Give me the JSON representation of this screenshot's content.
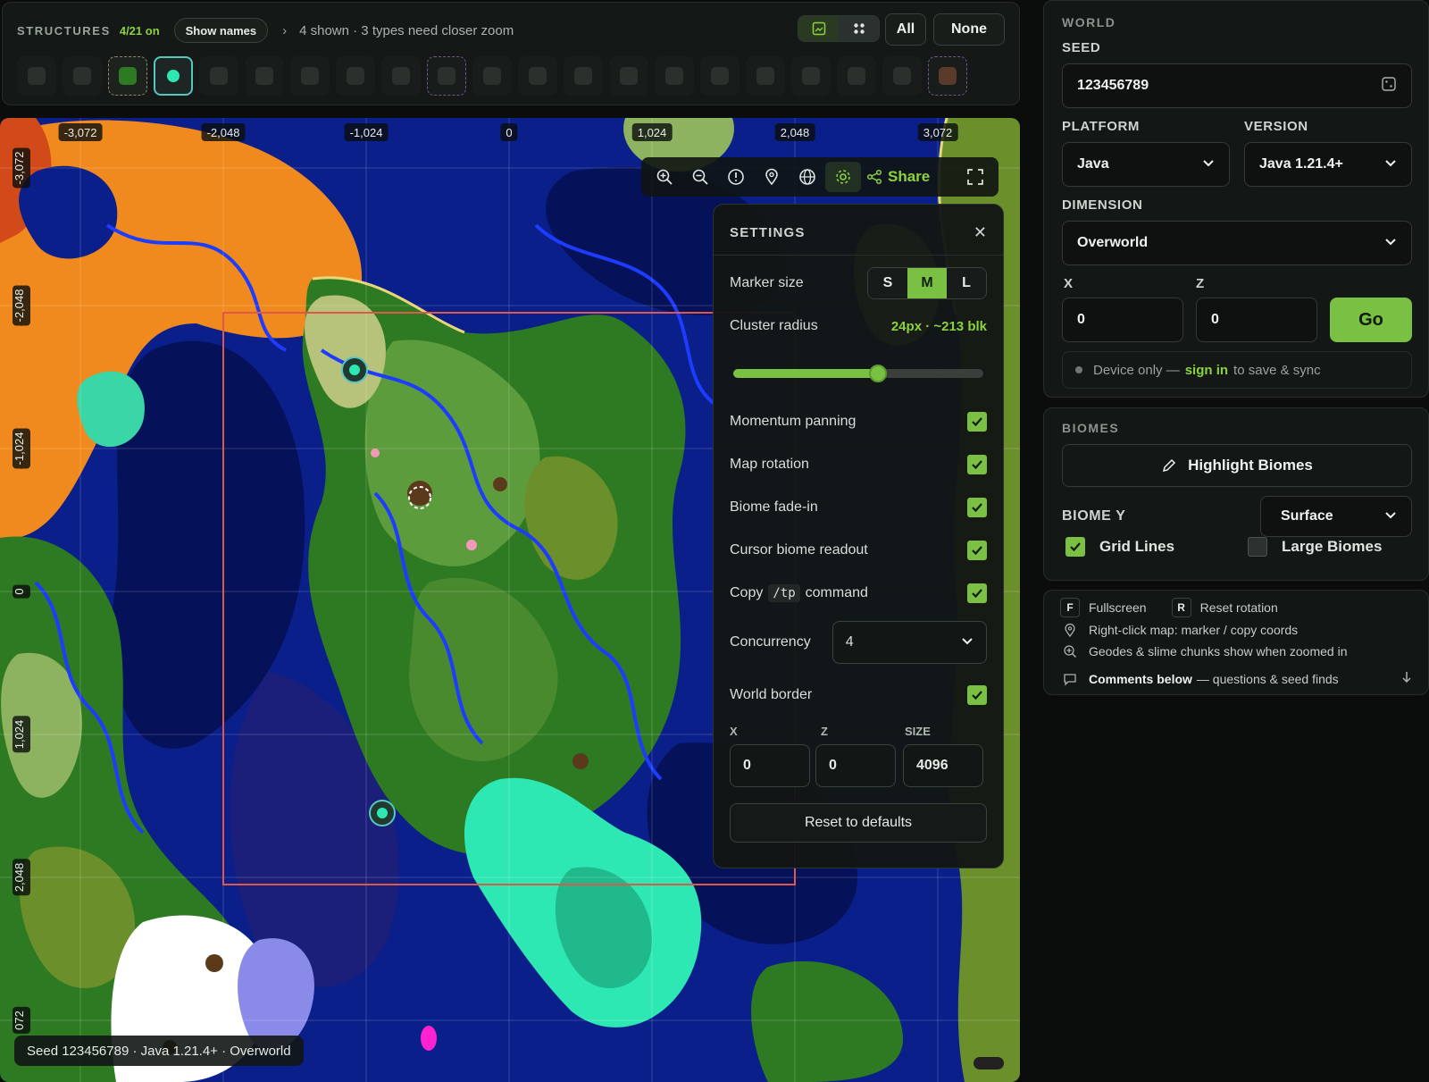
{
  "structures": {
    "title": "STRUCTURES",
    "count": "4/21 on",
    "show_names": "Show names",
    "summary": "4 shown · 3 types need closer zoom",
    "btn_all": "All",
    "btn_none": "None",
    "icons": [
      "ruined-portal-icon",
      "stone-icon",
      "end-city-icon",
      "stronghold-icon",
      "shipwreck-icon",
      "pillager-outpost-icon",
      "village-icon",
      "mineshaft-icon",
      "desert-temple-icon",
      "ancient-city-icon",
      "jungle-temple-icon",
      "witch-hut-icon",
      "igloo-icon",
      "bastion-icon",
      "ocean-monument-icon",
      "woodland-mansion-icon",
      "nether-fortress-icon",
      "ocean-ruin-icon",
      "trail-ruins-icon",
      "trial-chamber-icon",
      "buried-treasure-icon"
    ]
  },
  "map": {
    "top_coords": [
      "-3,072",
      "-2,048",
      "-1,024",
      "0",
      "1,024",
      "2,048",
      "3,072"
    ],
    "left_coords": [
      "-3,072",
      "-2,048",
      "-1,024",
      "0",
      "1,024",
      "2,048",
      "072"
    ],
    "share_label": "Share",
    "footer": "Seed 123456789 · Java 1.21.4+ · Overworld"
  },
  "settings": {
    "title": "SETTINGS",
    "marker_size_label": "Marker size",
    "marker_sizes": [
      "S",
      "M",
      "L"
    ],
    "marker_selected": "M",
    "cluster_label": "Cluster radius",
    "cluster_value": "24px · ~213 blk",
    "cluster_fraction": 0.58,
    "momentum": "Momentum panning",
    "rotation": "Map rotation",
    "fade": "Biome fade-in",
    "readout": "Cursor biome readout",
    "copy_pre": "Copy",
    "copy_code": "/tp",
    "copy_post": "command",
    "concurrency_label": "Concurrency",
    "concurrency_value": "4",
    "world_border": "World border",
    "wb_x_label": "X",
    "wb_z_label": "Z",
    "wb_size_label": "SIZE",
    "wb_x": "0",
    "wb_z": "0",
    "wb_size": "4096",
    "reset": "Reset to defaults"
  },
  "world": {
    "section": "WORLD",
    "seed_label": "SEED",
    "seed_value": "123456789",
    "platform_label": "PLATFORM",
    "platform_value": "Java",
    "version_label": "VERSION",
    "version_value": "Java 1.21.4+",
    "dimension_label": "DIMENSION",
    "dimension_value": "Overworld",
    "x_label": "X",
    "z_label": "Z",
    "x_value": "0",
    "z_value": "0",
    "go": "Go",
    "device_pre": "Device only —",
    "device_link": "sign in",
    "device_post": "to save & sync"
  },
  "biomes": {
    "section": "BIOMES",
    "highlight": "Highlight Biomes",
    "biome_y_label": "BIOME Y",
    "biome_y_value": "Surface",
    "grid_lines": "Grid Lines",
    "large_biomes": "Large Biomes"
  },
  "help": {
    "key_f": "F",
    "fullscreen": "Fullscreen",
    "key_r": "R",
    "reset_rotation": "Reset rotation",
    "right_click": "Right-click map: marker / copy coords",
    "geodes": "Geodes & slime chunks show when zoomed in",
    "comments_bold": "Comments below",
    "comments_rest": "— questions & seed finds"
  },
  "colors": {
    "accent": "#7ac143",
    "ocean": "#0a1f8a",
    "deep_ocean": "#05125a",
    "river": "#1e3cff",
    "badlands": "#f08a1e",
    "forest": "#2d7a22",
    "plains": "#8db360",
    "lush": "#2ee8b4",
    "snow": "#ffffff"
  }
}
